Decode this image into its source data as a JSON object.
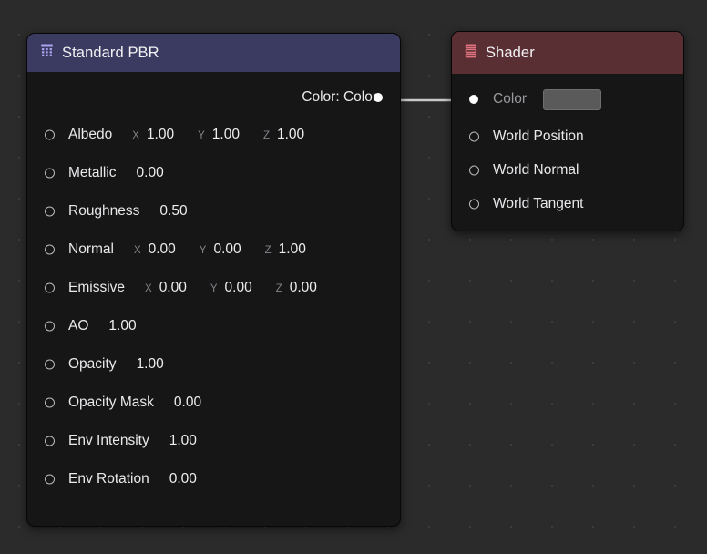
{
  "canvas": {
    "background_color": "#2b2b2b",
    "grid_dot_color": "#3c3c3c"
  },
  "nodes": [
    {
      "id": "standard-pbr",
      "title": "Standard PBR",
      "icon": "grid-texture-icon",
      "header_color": "#3b3a61",
      "icon_color": "#a9a1ee",
      "outputs": [
        {
          "label": "Color: Color",
          "connected": true
        }
      ],
      "inputs": [
        {
          "label": "Albedo",
          "type": "vector",
          "components": [
            {
              "axis": "X",
              "value": "1.00"
            },
            {
              "axis": "Y",
              "value": "1.00"
            },
            {
              "axis": "Z",
              "value": "1.00"
            }
          ]
        },
        {
          "label": "Metallic",
          "type": "scalar",
          "value": "0.00"
        },
        {
          "label": "Roughness",
          "type": "scalar",
          "value": "0.50"
        },
        {
          "label": "Normal",
          "type": "vector",
          "components": [
            {
              "axis": "X",
              "value": "0.00"
            },
            {
              "axis": "Y",
              "value": "0.00"
            },
            {
              "axis": "Z",
              "value": "1.00"
            }
          ]
        },
        {
          "label": "Emissive",
          "type": "vector",
          "components": [
            {
              "axis": "X",
              "value": "0.00"
            },
            {
              "axis": "Y",
              "value": "0.00"
            },
            {
              "axis": "Z",
              "value": "0.00"
            }
          ]
        },
        {
          "label": "AO",
          "type": "scalar",
          "value": "1.00"
        },
        {
          "label": "Opacity",
          "type": "scalar",
          "value": "1.00"
        },
        {
          "label": "Opacity Mask",
          "type": "scalar",
          "value": "0.00"
        },
        {
          "label": "Env Intensity",
          "type": "scalar",
          "value": "1.00"
        },
        {
          "label": "Env Rotation",
          "type": "scalar",
          "value": "0.00"
        }
      ]
    },
    {
      "id": "shader",
      "title": "Shader",
      "icon": "layers-stack-icon",
      "header_color": "#5a2f34",
      "icon_color": "#e0737e",
      "inputs": [
        {
          "label": "Color",
          "type": "color",
          "swatch": "#5a5a5a",
          "connected": true
        },
        {
          "label": "World Position",
          "type": "none",
          "connected": false
        },
        {
          "label": "World Normal",
          "type": "none",
          "connected": false
        },
        {
          "label": "World Tangent",
          "type": "none",
          "connected": false
        }
      ]
    }
  ],
  "connection": {
    "color": "#c9c9c9",
    "from": "Color: Color",
    "to": "Color"
  }
}
